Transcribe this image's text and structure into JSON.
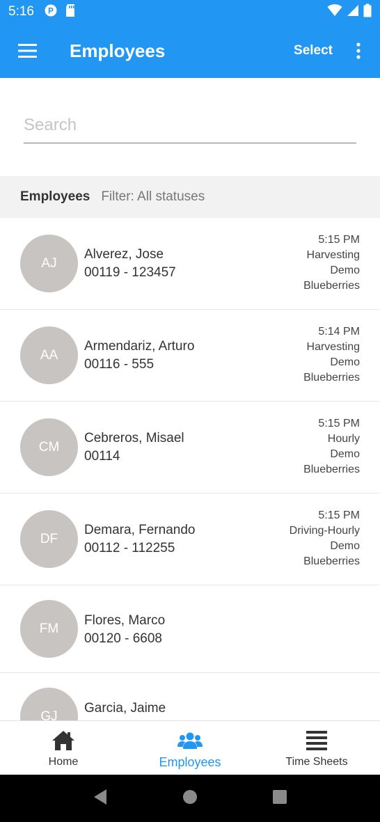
{
  "status_bar": {
    "time": "5:16",
    "icons": [
      "data-saver-icon",
      "sd-card-icon",
      "wifi-icon",
      "signal-icon",
      "battery-icon"
    ]
  },
  "app_bar": {
    "title": "Employees",
    "select_label": "Select",
    "icons": [
      "menu-icon",
      "more-vert-icon"
    ]
  },
  "search": {
    "placeholder": "Search",
    "value": ""
  },
  "list_header": {
    "title": "Employees",
    "filter": "Filter: All statuses"
  },
  "employees": [
    {
      "initials": "AJ",
      "name": "Alverez, Jose",
      "id": "00119 - 123457",
      "time": "5:15 PM",
      "activity": "Harvesting",
      "group": "Demo",
      "crop": "Blueberries"
    },
    {
      "initials": "AA",
      "name": "Armendariz, Arturo",
      "id": "00116 - 555",
      "time": "5:14 PM",
      "activity": "Harvesting",
      "group": "Demo",
      "crop": "Blueberries"
    },
    {
      "initials": "CM",
      "name": "Cebreros, Misael",
      "id": "00114",
      "time": "5:15 PM",
      "activity": "Hourly",
      "group": "Demo",
      "crop": "Blueberries"
    },
    {
      "initials": "DF",
      "name": "Demara, Fernando",
      "id": "00112 - 112255",
      "time": "5:15 PM",
      "activity": "Driving-Hourly",
      "group": "Demo",
      "crop": "Blueberries"
    },
    {
      "initials": "FM",
      "name": "Flores, Marco",
      "id": "00120 - 6608"
    },
    {
      "initials": "GJ",
      "name": "Garcia, Jaime"
    }
  ],
  "bottom_nav": {
    "items": [
      {
        "label": "Home",
        "icon": "home-icon"
      },
      {
        "label": "Employees",
        "icon": "people-icon",
        "active": true
      },
      {
        "label": "Time Sheets",
        "icon": "list-icon"
      }
    ]
  },
  "system_nav": {
    "icons": [
      "back-icon",
      "home-circle-icon",
      "recents-icon"
    ]
  },
  "colors": {
    "primary": "#2196f3",
    "avatar_bg": "#c8c4c2",
    "header_bg": "#f2f2f2",
    "active_nav": "#2196f3"
  }
}
